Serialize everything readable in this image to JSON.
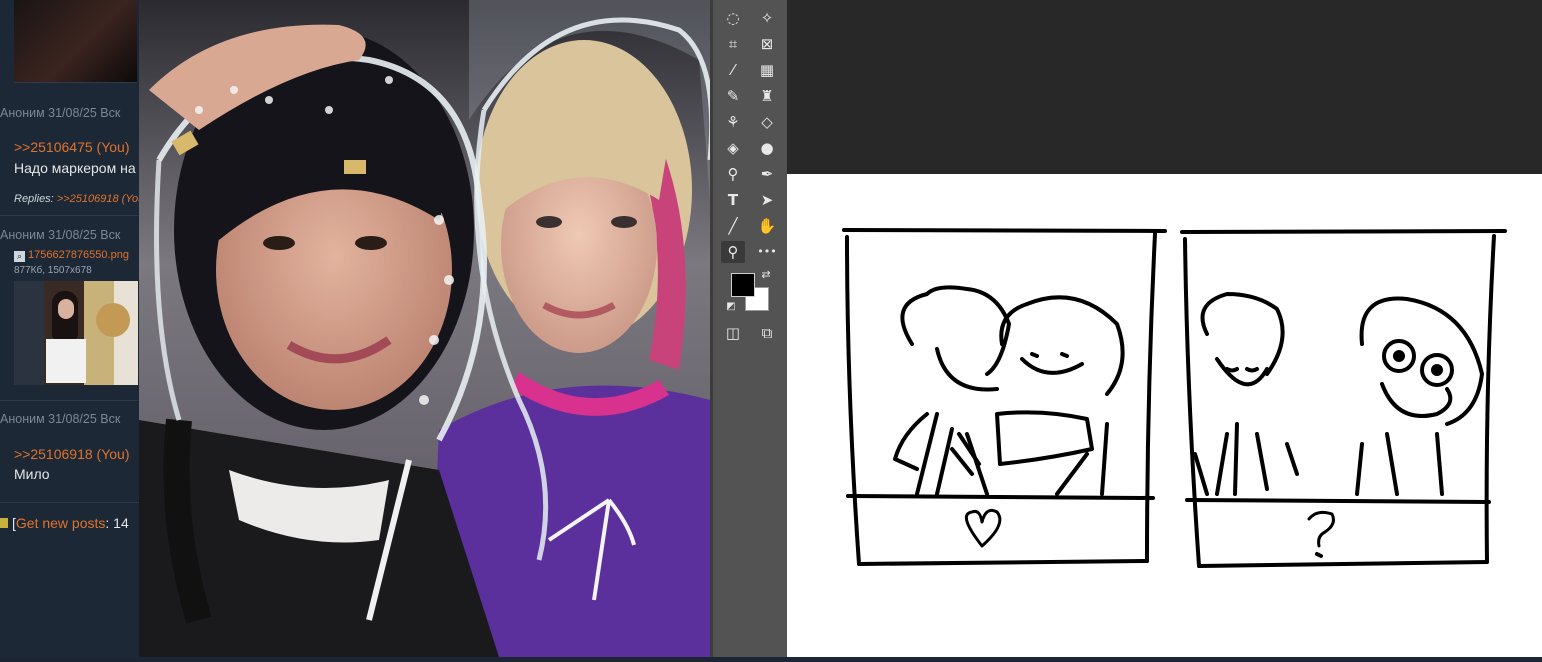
{
  "forum": {
    "posts": [
      {
        "header": "Аноним 31/08/25 Вск",
        "reply_link": ">>25106475 (You)",
        "text": "Надо маркером на",
        "replies_label": "Replies:",
        "replies_link": ">>25106918 (You"
      },
      {
        "header": "Аноним 31/08/25 Вск",
        "file_name": "1756627876550.png",
        "file_meta": "877Кб, 1507x678"
      },
      {
        "header": "Аноним 31/08/25 Вск",
        "reply_link": ">>25106918 (You)",
        "text": "Мило"
      }
    ],
    "new_posts": {
      "open": "[",
      "link": "Get new posts",
      "rest": ": 14"
    }
  },
  "photo": {
    "description_hidden": ""
  },
  "toolbar": {
    "tools": [
      {
        "name": "lasso-tool-icon",
        "glyph": "◌"
      },
      {
        "name": "magic-wand-tool-icon",
        "glyph": "✧"
      },
      {
        "name": "crop-tool-icon",
        "glyph": "⌗"
      },
      {
        "name": "frame-tool-icon",
        "glyph": "⊠"
      },
      {
        "name": "eyedropper-tool-icon",
        "glyph": "⁄"
      },
      {
        "name": "healing-brush-tool-icon",
        "glyph": "▦"
      },
      {
        "name": "brush-tool-icon",
        "glyph": "✎"
      },
      {
        "name": "clone-stamp-tool-icon",
        "glyph": "♜"
      },
      {
        "name": "history-brush-tool-icon",
        "glyph": "⚘"
      },
      {
        "name": "eraser-tool-icon",
        "glyph": "◇"
      },
      {
        "name": "paint-bucket-tool-icon",
        "glyph": "◈"
      },
      {
        "name": "blur-tool-icon",
        "glyph": "●"
      },
      {
        "name": "dodge-tool-icon",
        "glyph": "⚲"
      },
      {
        "name": "pen-tool-icon",
        "glyph": "✒"
      },
      {
        "name": "type-tool-icon",
        "glyph": "T"
      },
      {
        "name": "path-selection-tool-icon",
        "glyph": "➤"
      },
      {
        "name": "line-tool-icon",
        "glyph": "╱"
      },
      {
        "name": "hand-tool-icon",
        "glyph": "✋"
      },
      {
        "name": "zoom-tool-icon",
        "glyph": "⚲"
      },
      {
        "name": "more-tools-icon",
        "glyph": "•••"
      },
      {
        "name": "quick-mask-icon",
        "glyph": "◫"
      },
      {
        "name": "screen-mode-icon",
        "glyph": "⧉"
      }
    ],
    "colors": {
      "foreground": "#000000",
      "background": "#ffffff"
    }
  }
}
